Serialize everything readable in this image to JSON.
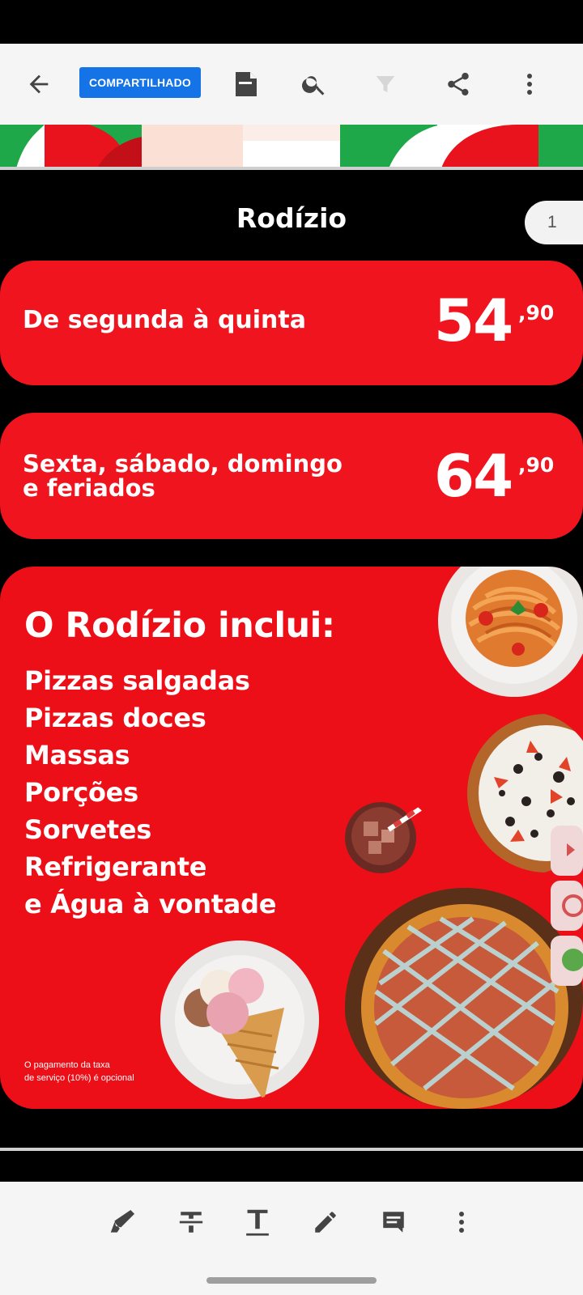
{
  "toolbar": {
    "back_icon": "arrow-left-icon",
    "badge_label": "COMPARTILHADO",
    "icons": [
      "document-icon",
      "search-icon",
      "filter-icon",
      "share-icon",
      "more-vertical-icon"
    ]
  },
  "document": {
    "title": "Rodízio",
    "page_number": "1",
    "prices": [
      {
        "label_lines": [
          "De segunda à quinta"
        ],
        "price": "54",
        "cents": ",90"
      },
      {
        "label_lines": [
          "Sexta, sábado, domingo",
          "e feriados"
        ],
        "price": "64",
        "cents": ",90"
      }
    ],
    "includes": {
      "title": "O Rodízio inclui:",
      "items": [
        "Pizzas salgadas",
        "Pizzas doces",
        "Massas",
        "Porções",
        "Sorvetes",
        "Refrigerante",
        "e Água à vontade"
      ],
      "footnote_lines": [
        "O pagamento da taxa",
        "de serviço (10%) é opcional"
      ]
    }
  },
  "bottom_toolbar": {
    "icons": [
      "highlighter-icon",
      "strikethrough-icon",
      "text-underline-icon",
      "pencil-icon",
      "comment-icon",
      "more-vertical-icon"
    ]
  },
  "colors": {
    "card_red": "#f0141e",
    "badge_blue": "#1473e6",
    "page_bg": "#000000",
    "toolbar_bg": "#f5f5f5"
  }
}
